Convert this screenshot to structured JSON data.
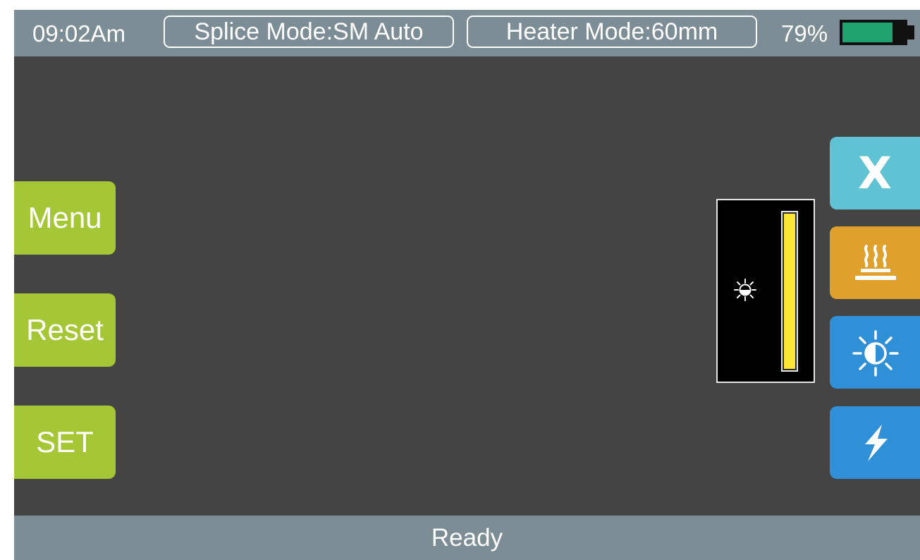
{
  "status_bar": {
    "time": "09:02Am",
    "splice_mode": "Splice Mode:SM Auto",
    "heater_mode": "Heater Mode:60mm",
    "battery_percent_label": "79%",
    "battery_level": 0.79,
    "battery_fill_color": "#1ea36f"
  },
  "left_buttons": {
    "menu": "Menu",
    "reset": "Reset",
    "set": "SET"
  },
  "brightness": {
    "level": 1.0,
    "icon": "brightness-half-icon"
  },
  "right_buttons": {
    "close": {
      "label": "X",
      "icon": "close-icon",
      "color": "#5fc3d3"
    },
    "heater": {
      "icon": "heater-icon",
      "color": "#dfa12c"
    },
    "brightness": {
      "icon": "brightness-icon",
      "color": "#2f8fd7"
    },
    "arc": {
      "icon": "lightning-icon",
      "color": "#2f8fd7"
    }
  },
  "footer": {
    "status": "Ready"
  },
  "colors": {
    "accent_green": "#a6c735",
    "screen_bg": "#444444",
    "bar_bg": "#7c8d95",
    "slider_yellow": "#ffe535"
  }
}
